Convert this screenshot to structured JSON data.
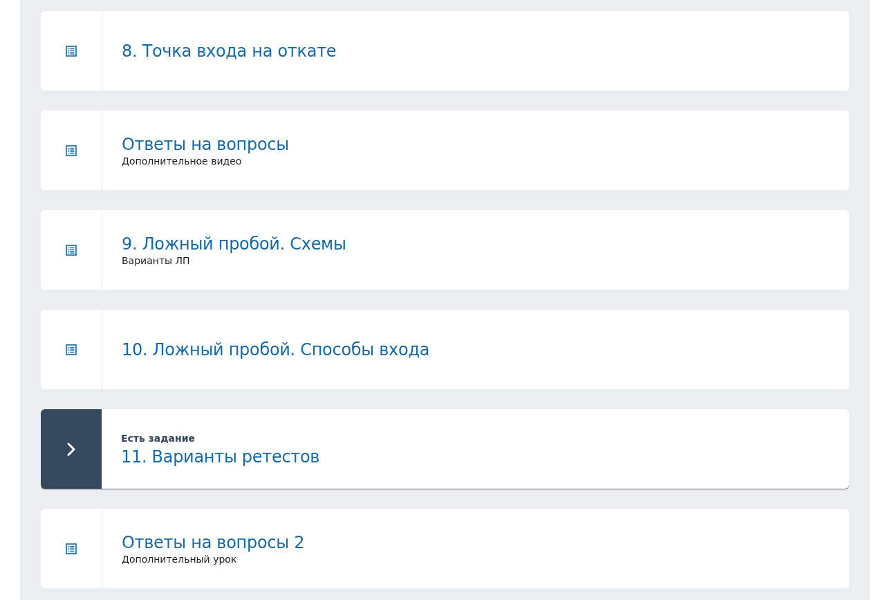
{
  "lessons": [
    {
      "title": "8. Точка входа на откате",
      "selected": false
    },
    {
      "title": "Ответы на вопросы",
      "subtitle": "Дополнительное видео",
      "selected": false
    },
    {
      "title": "9. Ложный пробой. Схемы",
      "subtitle": "Варианты ЛП",
      "selected": false
    },
    {
      "title": "10. Ложный пробой. Способы входа",
      "selected": false
    },
    {
      "title": "11. Варианты ретестов",
      "note": "Есть задание",
      "selected": true
    },
    {
      "title": "Ответы на вопросы 2",
      "subtitle": "Дополнительный урок",
      "selected": false
    }
  ]
}
